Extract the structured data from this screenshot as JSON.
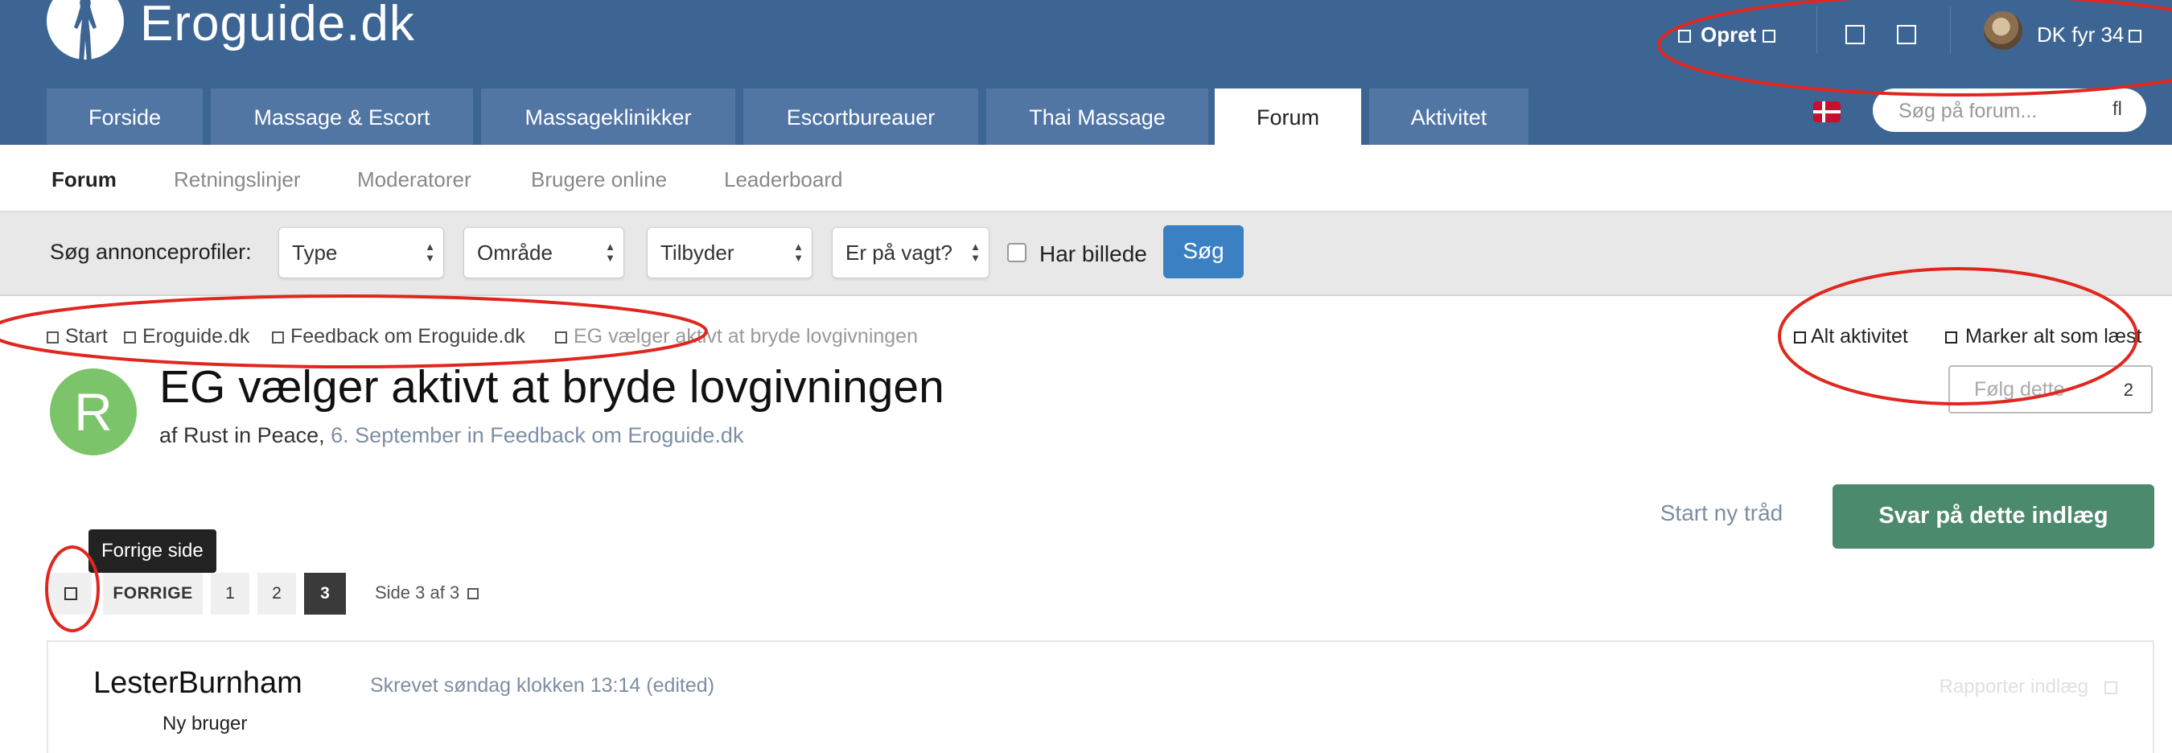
{
  "site": {
    "name": "Eroguide.dk"
  },
  "user_nav": {
    "create_label": "Opret",
    "username": "DK fyr 34"
  },
  "nav": {
    "tabs": [
      {
        "label": "Forside"
      },
      {
        "label": "Massage & Escort"
      },
      {
        "label": "Massageklinikker"
      },
      {
        "label": "Escortbureauer"
      },
      {
        "label": "Thai Massage"
      },
      {
        "label": "Forum"
      },
      {
        "label": "Aktivitet"
      }
    ],
    "active_tab": "Forum",
    "search_placeholder": "Søg på forum...",
    "search_icon_glyph": "fl"
  },
  "subnav": {
    "items": [
      {
        "label": "Forum"
      },
      {
        "label": "Retningslinjer"
      },
      {
        "label": "Moderatorer"
      },
      {
        "label": "Brugere online"
      },
      {
        "label": "Leaderboard"
      }
    ]
  },
  "filters": {
    "label": "Søg annonceprofiler:",
    "selects": [
      {
        "value": "Type"
      },
      {
        "value": "Område"
      },
      {
        "value": "Tilbyder"
      },
      {
        "value": "Er på vagt?"
      }
    ],
    "checkbox_label": "Har billede",
    "search_button": "Søg"
  },
  "breadcrumb": {
    "items": [
      {
        "label": "Start"
      },
      {
        "label": "Eroguide.dk"
      },
      {
        "label": "Feedback om Eroguide.dk"
      },
      {
        "label": "EG vælger aktivt at bryde lovgivningen"
      }
    ],
    "all_activity": "Alt aktivitet",
    "mark_read": "Marker alt som læst"
  },
  "topic": {
    "avatar_letter": "R",
    "title": "EG vælger aktivt at bryde lovgivningen",
    "meta_prefix": "af",
    "author": "Rust in Peace",
    "date_and_forum": "6. September in Feedback om Eroguide.dk",
    "follow_label": "Følg dette",
    "follow_count": "2",
    "new_thread_label": "Start ny tråd",
    "reply_label": "Svar på dette indlæg"
  },
  "pagination": {
    "tooltip": "Forrige side",
    "prev_label": "FORRIGE",
    "pages": [
      "1",
      "2",
      "3"
    ],
    "current_page": "3",
    "status": "Side 3 af 3"
  },
  "post": {
    "author": "LesterBurnham",
    "date": "Skrevet søndag klokken 13:14 (edited)",
    "report_label": "Rapporter indlæg",
    "rank": "Ny bruger"
  },
  "colors": {
    "header_bg": "#3d6594",
    "tab_bg": "#5276a4",
    "search_button": "#3a80c3",
    "reply_button": "#4c8a6e",
    "avatar_bg": "#7cc46a",
    "annotation": "#e0271f"
  }
}
